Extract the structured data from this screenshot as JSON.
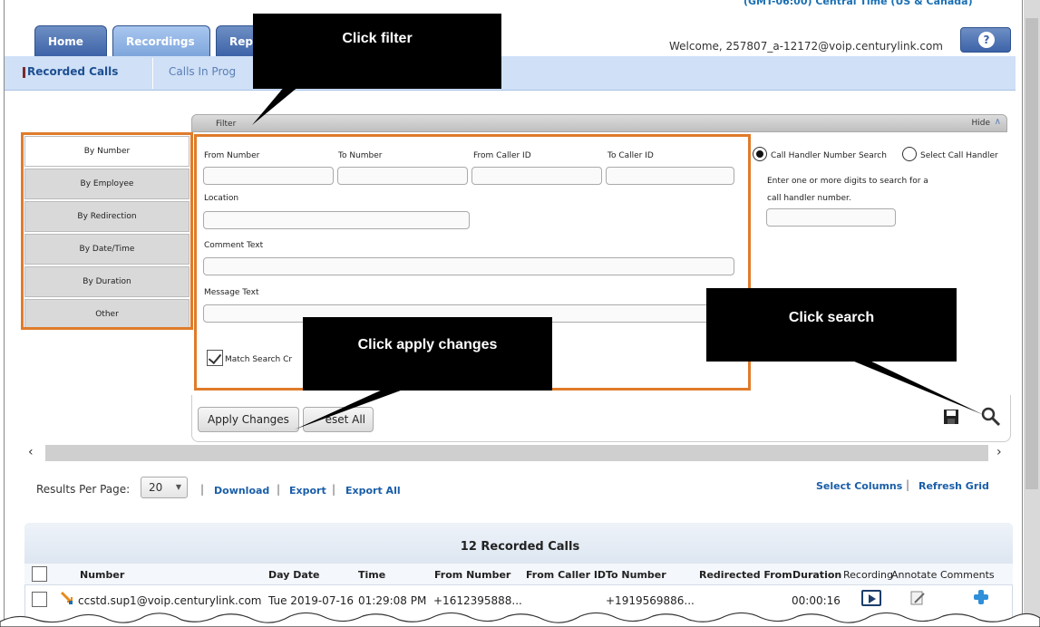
{
  "header": {
    "timezone": "(GMT-06:00) Central Time (US & Canada)",
    "tabs": [
      {
        "label": "Home"
      },
      {
        "label": "Recordings"
      },
      {
        "label": "Rep"
      }
    ],
    "welcome": "Welcome, 257807_a-12172@voip.centurylink.com",
    "help_icon": "question-icon"
  },
  "subnav": {
    "active": "Recorded Calls",
    "other": "Calls In Prog"
  },
  "filter": {
    "title": "Filter",
    "hide": "Hide",
    "side_buttons": [
      "By Number",
      "By Employee",
      "By Redirection",
      "By Date/Time",
      "By Duration",
      "Other"
    ],
    "labels": {
      "from_number": "From Number",
      "to_number": "To Number",
      "from_caller_id": "From Caller ID",
      "to_caller_id": "To Caller ID",
      "location": "Location",
      "comment_text": "Comment Text",
      "message_text": "Message Text",
      "match_search": "Match Search Cr"
    },
    "right": {
      "radio1": "Call Handler Number Search",
      "radio2": "Select Call Handler",
      "hint1": "Enter one or more digits to search for a",
      "hint2": "call handler number."
    }
  },
  "actions": {
    "apply": "Apply Changes",
    "reset": "eset All",
    "save_icon": "floppy-icon",
    "search_icon": "magnifier-icon"
  },
  "results": {
    "per_page_label": "Results Per Page:",
    "per_page_value": "20",
    "download": "Download",
    "export": "Export",
    "export_all": "Export All",
    "select_columns": "Select Columns",
    "refresh_grid": "Refresh Grid"
  },
  "grid": {
    "title": "12 Recorded Calls",
    "columns": [
      "Number",
      "Day Date",
      "Time",
      "From Number",
      "From Caller ID",
      "To Number",
      "Redirected From",
      "Duration",
      "Recording",
      "Annotate",
      "Comments"
    ],
    "rows": [
      {
        "number": "ccstd.sup1@voip.centurylink.com",
        "day_date": "Tue 2019-07-16",
        "time": "01:29:08 PM",
        "from_number": "+1612395888...",
        "to_number": "+1919569886...",
        "duration": "00:00:16"
      }
    ]
  },
  "callouts": {
    "filter": "Click filter",
    "search": "Click search",
    "apply": "Click apply changes"
  }
}
